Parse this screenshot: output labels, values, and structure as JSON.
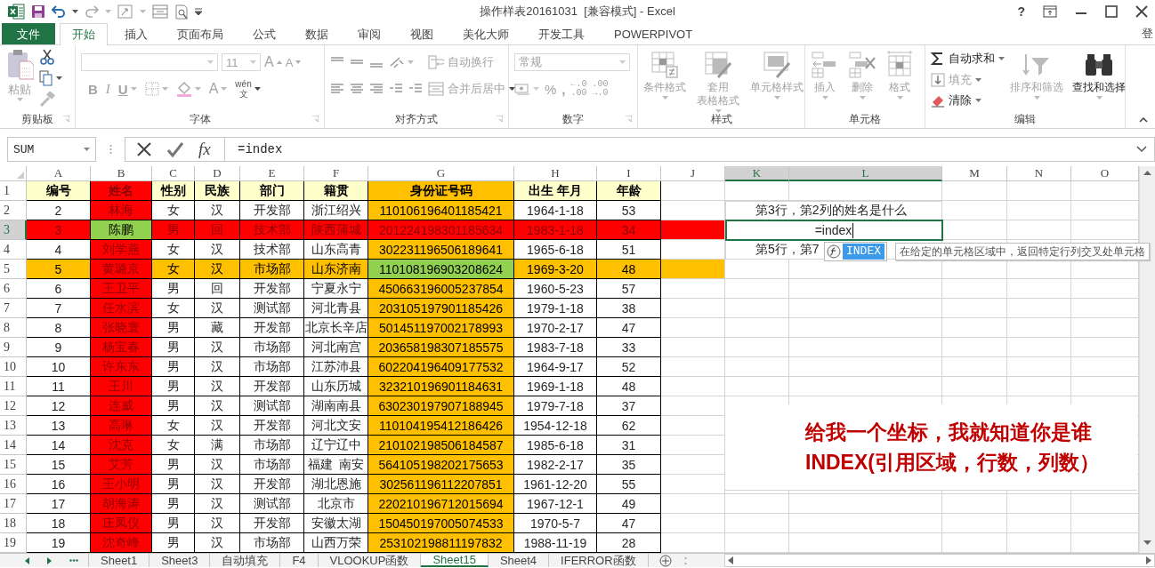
{
  "title_bar": {
    "title": "操作样表20161031  [兼容模式] - Excel",
    "help": "?"
  },
  "ribbon_tabs": [
    {
      "label": "文件",
      "kind": "file",
      "selected": false
    },
    {
      "label": "开始",
      "kind": "tab",
      "selected": true
    },
    {
      "label": "插入",
      "kind": "tab",
      "selected": false
    },
    {
      "label": "页面布局",
      "kind": "tab",
      "selected": false
    },
    {
      "label": "公式",
      "kind": "tab",
      "selected": false
    },
    {
      "label": "数据",
      "kind": "tab",
      "selected": false
    },
    {
      "label": "审阅",
      "kind": "tab",
      "selected": false
    },
    {
      "label": "视图",
      "kind": "tab",
      "selected": false
    },
    {
      "label": "美化大师",
      "kind": "tab",
      "selected": false
    },
    {
      "label": "开发工具",
      "kind": "tab",
      "selected": false
    },
    {
      "label": "POWERPIVOT",
      "kind": "tab",
      "selected": false
    }
  ],
  "account": "登",
  "ribbon": {
    "groups": [
      {
        "label": "剪贴板",
        "kind": "clipboard",
        "paste": {
          "label": "粘贴",
          "disabled": true
        }
      },
      {
        "label": "字体",
        "kind": "font",
        "font_size": "11",
        "grow": "A",
        "shrink": "A",
        "bold": "B",
        "italic": "I",
        "underline": "U",
        "font_color": "A",
        "phonetic": {
          "top": "wén",
          "bottom": "文"
        }
      },
      {
        "label": "对齐方式",
        "kind": "alignment",
        "wrap": {
          "label": "自动换行",
          "disabled": true
        },
        "merge": {
          "label": "合并后居中",
          "disabled": true
        }
      },
      {
        "label": "数字",
        "kind": "number",
        "format": "常规",
        "percent": "%",
        "comma": ",",
        "decimals": [
          {
            "top": "←.0",
            "bottom": ".00"
          },
          {
            "top": ".00",
            "bottom": "→.0"
          }
        ]
      },
      {
        "label": "样式",
        "kind": "large",
        "commands": [
          {
            "lines": [
              "条件格式"
            ],
            "disabled": true
          },
          {
            "lines": [
              "套用",
              "表格格式"
            ],
            "disabled": true
          },
          {
            "lines": [
              "单元格样式"
            ],
            "disabled": true
          }
        ]
      },
      {
        "label": "单元格",
        "kind": "large",
        "commands": [
          {
            "lines": [
              "插入"
            ],
            "disabled": true
          },
          {
            "lines": [
              "删除"
            ],
            "disabled": true
          },
          {
            "lines": [
              "格式"
            ],
            "disabled": true
          }
        ]
      },
      {
        "label": "编辑",
        "kind": "editing",
        "small": [
          {
            "label": "自动求和",
            "disabled": false
          },
          {
            "label": "填充",
            "disabled": true
          },
          {
            "label": "清除",
            "disabled": false
          }
        ],
        "large": [
          {
            "lines": [
              "排序和筛选"
            ],
            "disabled": true
          },
          {
            "lines": [
              "查找和选择"
            ],
            "disabled": false
          }
        ]
      }
    ]
  },
  "formula_bar": {
    "name_box": "SUM",
    "function_button": "fx",
    "content": "=index"
  },
  "grid": {
    "columns": [
      {
        "letter": "A",
        "selected": false
      },
      {
        "letter": "B",
        "selected": false
      },
      {
        "letter": "C",
        "selected": false
      },
      {
        "letter": "D",
        "selected": false
      },
      {
        "letter": "E",
        "selected": false
      },
      {
        "letter": "F",
        "selected": false
      },
      {
        "letter": "G",
        "selected": false
      },
      {
        "letter": "H",
        "selected": false
      },
      {
        "letter": "I",
        "selected": false
      },
      {
        "letter": "J",
        "selected": false
      },
      {
        "letter": "K",
        "selected": true
      },
      {
        "letter": "L",
        "selected": true
      },
      {
        "letter": "M",
        "selected": false
      },
      {
        "letter": "N",
        "selected": false
      },
      {
        "letter": "O",
        "selected": false
      }
    ],
    "rows": [
      {
        "header": "1",
        "selected": false,
        "kind": "header",
        "cells": [
          {
            "text": "编号",
            "color": "#ffffcc"
          },
          {
            "text": "姓名",
            "color": "#ff0000"
          },
          {
            "text": "性别",
            "color": "#ffffcc"
          },
          {
            "text": "民族",
            "color": "#ffffcc"
          },
          {
            "text": "部门",
            "color": "#ffffcc"
          },
          {
            "text": "籍贯",
            "color": "#ffffcc"
          },
          {
            "text": "身份证号码",
            "color": "#ffc000"
          },
          {
            "text": "出生 年月",
            "color": "#ffffcc"
          },
          {
            "text": "年龄",
            "color": "#ffffcc"
          }
        ]
      },
      {
        "header": "2",
        "selected": false,
        "kind": "data",
        "cells": [
          {
            "text": "2"
          },
          {
            "text": "林海",
            "color": "#ff0000"
          },
          {
            "text": "女"
          },
          {
            "text": "汉"
          },
          {
            "text": "开发部"
          },
          {
            "text": "浙江绍兴"
          },
          {
            "text": "110106196401185421",
            "color": "#ffc000"
          },
          {
            "text": "1964-1-18"
          },
          {
            "text": "53"
          }
        ]
      },
      {
        "header": "3",
        "selected": true,
        "kind": "data",
        "cells": [
          {
            "text": "3",
            "color": "#ff0000"
          },
          {
            "text": "陈鹏",
            "color": "#92d050"
          },
          {
            "text": "男",
            "color": "#ff0000"
          },
          {
            "text": "回",
            "color": "#ff0000"
          },
          {
            "text": "技术部",
            "color": "#ff0000"
          },
          {
            "text": "陕西蒲城",
            "color": "#ff0000"
          },
          {
            "text": "201224198301185634",
            "color": "#ff0000"
          },
          {
            "text": "1983-1-18",
            "color": "#ff0000"
          },
          {
            "text": "34",
            "color": "#ff0000"
          },
          {
            "color": "#ff0000"
          }
        ]
      },
      {
        "header": "4",
        "selected": false,
        "kind": "data",
        "cells": [
          {
            "text": "4"
          },
          {
            "text": "刘学燕",
            "color": "#ff0000"
          },
          {
            "text": "女"
          },
          {
            "text": "汉"
          },
          {
            "text": "技术部"
          },
          {
            "text": "山东高青"
          },
          {
            "text": "302231196506189641",
            "color": "#ffc000"
          },
          {
            "text": "1965-6-18"
          },
          {
            "text": "51"
          }
        ]
      },
      {
        "header": "5",
        "selected": false,
        "kind": "data",
        "cells": [
          {
            "text": "5",
            "color": "#ffc000"
          },
          {
            "text": "黄璐京",
            "color": "#ff0000"
          },
          {
            "text": "女",
            "color": "#ffc000"
          },
          {
            "text": "汉",
            "color": "#ffc000"
          },
          {
            "text": "市场部",
            "color": "#ffc000"
          },
          {
            "text": "山东济南",
            "color": "#ffc000"
          },
          {
            "text": "110108196903208624",
            "color": "#92d050"
          },
          {
            "text": "1969-3-20",
            "color": "#ffc000"
          },
          {
            "text": "48",
            "color": "#ffc000"
          },
          {
            "color": "#ffc000"
          }
        ]
      },
      {
        "header": "6",
        "selected": false,
        "kind": "data",
        "cells": [
          {
            "text": "6"
          },
          {
            "text": "王卫平",
            "color": "#ff0000"
          },
          {
            "text": "男"
          },
          {
            "text": "回"
          },
          {
            "text": "开发部"
          },
          {
            "text": "宁夏永宁"
          },
          {
            "text": "450663196005237854",
            "color": "#ffc000"
          },
          {
            "text": "1960-5-23"
          },
          {
            "text": "57"
          }
        ]
      },
      {
        "header": "7",
        "selected": false,
        "kind": "data",
        "cells": [
          {
            "text": "7"
          },
          {
            "text": "任水滨",
            "color": "#ff0000"
          },
          {
            "text": "女"
          },
          {
            "text": "汉"
          },
          {
            "text": "测试部"
          },
          {
            "text": "河北青县"
          },
          {
            "text": "203105197901185426",
            "color": "#ffc000"
          },
          {
            "text": "1979-1-18"
          },
          {
            "text": "38"
          }
        ]
      },
      {
        "header": "8",
        "selected": false,
        "kind": "data",
        "cells": [
          {
            "text": "8"
          },
          {
            "text": "张晓寰",
            "color": "#ff0000"
          },
          {
            "text": "男"
          },
          {
            "text": "藏"
          },
          {
            "text": "开发部"
          },
          {
            "text": "北京长辛店"
          },
          {
            "text": "501451197002178993",
            "color": "#ffc000"
          },
          {
            "text": "1970-2-17"
          },
          {
            "text": "47"
          }
        ]
      },
      {
        "header": "9",
        "selected": false,
        "kind": "data",
        "cells": [
          {
            "text": "9"
          },
          {
            "text": "杨宝春",
            "color": "#ff0000"
          },
          {
            "text": "男"
          },
          {
            "text": "汉"
          },
          {
            "text": "市场部"
          },
          {
            "text": "河北南宫"
          },
          {
            "text": "203658198307185575",
            "color": "#ffc000"
          },
          {
            "text": "1983-7-18"
          },
          {
            "text": "33"
          }
        ]
      },
      {
        "header": "10",
        "selected": false,
        "kind": "data",
        "cells": [
          {
            "text": "10"
          },
          {
            "text": "许东东",
            "color": "#ff0000"
          },
          {
            "text": "男"
          },
          {
            "text": "汉"
          },
          {
            "text": "市场部"
          },
          {
            "text": "江苏沛县"
          },
          {
            "text": "602204196409177532",
            "color": "#ffc000"
          },
          {
            "text": "1964-9-17"
          },
          {
            "text": "52"
          }
        ]
      },
      {
        "header": "11",
        "selected": false,
        "kind": "data",
        "cells": [
          {
            "text": "11"
          },
          {
            "text": "王川",
            "color": "#ff0000"
          },
          {
            "text": "男"
          },
          {
            "text": "汉"
          },
          {
            "text": "开发部"
          },
          {
            "text": "山东历城"
          },
          {
            "text": "323210196901184631",
            "color": "#ffc000"
          },
          {
            "text": "1969-1-18"
          },
          {
            "text": "48"
          }
        ]
      },
      {
        "header": "12",
        "selected": false,
        "kind": "data",
        "cells": [
          {
            "text": "12"
          },
          {
            "text": "连威",
            "color": "#ff0000"
          },
          {
            "text": "男"
          },
          {
            "text": "汉"
          },
          {
            "text": "测试部"
          },
          {
            "text": "湖南南县"
          },
          {
            "text": "630230197907188945",
            "color": "#ffc000"
          },
          {
            "text": "1979-7-18"
          },
          {
            "text": "37"
          }
        ]
      },
      {
        "header": "13",
        "selected": false,
        "kind": "data",
        "cells": [
          {
            "text": "13"
          },
          {
            "text": "高琳",
            "color": "#ff0000"
          },
          {
            "text": "女"
          },
          {
            "text": "汉"
          },
          {
            "text": "开发部"
          },
          {
            "text": "河北文安"
          },
          {
            "text": "110104195412186426",
            "color": "#ffc000"
          },
          {
            "text": "1954-12-18"
          },
          {
            "text": "62"
          }
        ]
      },
      {
        "header": "14",
        "selected": false,
        "kind": "data",
        "cells": [
          {
            "text": "14"
          },
          {
            "text": "沈克",
            "color": "#ff0000"
          },
          {
            "text": "女"
          },
          {
            "text": "满"
          },
          {
            "text": "市场部"
          },
          {
            "text": "辽宁辽中"
          },
          {
            "text": "210102198506184587",
            "color": "#ffc000"
          },
          {
            "text": "1985-6-18"
          },
          {
            "text": "31"
          }
        ]
      },
      {
        "header": "15",
        "selected": false,
        "kind": "data",
        "cells": [
          {
            "text": "15"
          },
          {
            "text": "艾芳",
            "color": "#ff0000"
          },
          {
            "text": "男"
          },
          {
            "text": "汉"
          },
          {
            "text": "市场部"
          },
          {
            "text": "福建  南安"
          },
          {
            "text": "564105198202175653",
            "color": "#ffc000"
          },
          {
            "text": "1982-2-17"
          },
          {
            "text": "35"
          }
        ]
      },
      {
        "header": "16",
        "selected": false,
        "kind": "data",
        "cells": [
          {
            "text": "16"
          },
          {
            "text": "王小明",
            "color": "#ff0000"
          },
          {
            "text": "男"
          },
          {
            "text": "汉"
          },
          {
            "text": "开发部"
          },
          {
            "text": "湖北恩施"
          },
          {
            "text": "302561196112207851",
            "color": "#ffc000"
          },
          {
            "text": "1961-12-20"
          },
          {
            "text": "55"
          }
        ]
      },
      {
        "header": "17",
        "selected": false,
        "kind": "data",
        "cells": [
          {
            "text": "17"
          },
          {
            "text": "胡海涛",
            "color": "#ff0000"
          },
          {
            "text": "男"
          },
          {
            "text": "汉"
          },
          {
            "text": "测试部"
          },
          {
            "text": "北京市"
          },
          {
            "text": "220210196712015694",
            "color": "#ffc000"
          },
          {
            "text": "1967-12-1"
          },
          {
            "text": "49"
          }
        ]
      },
      {
        "header": "18",
        "selected": false,
        "kind": "data",
        "cells": [
          {
            "text": "18"
          },
          {
            "text": "庄凤仪",
            "color": "#ff0000"
          },
          {
            "text": "男"
          },
          {
            "text": "汉"
          },
          {
            "text": "开发部"
          },
          {
            "text": "安徽太湖"
          },
          {
            "text": "150450197005074533",
            "color": "#ffc000"
          },
          {
            "text": "1970-5-7"
          },
          {
            "text": "47"
          }
        ]
      },
      {
        "header": "19",
        "selected": false,
        "kind": "data",
        "cells": [
          {
            "text": "19"
          },
          {
            "text": "沈奇峰",
            "color": "#ff0000"
          },
          {
            "text": "男"
          },
          {
            "text": "汉"
          },
          {
            "text": "市场部"
          },
          {
            "text": "山西万荣"
          },
          {
            "text": "253102198811197832",
            "color": "#ffc000"
          },
          {
            "text": "1988-11-19"
          },
          {
            "text": "28"
          }
        ]
      }
    ]
  },
  "sheet_overlay": {
    "question_1": "第3行，第2列的姓名是什么",
    "active_cell": "=index",
    "question_2": "第5行，第7",
    "autocomplete": {
      "items": [
        {
          "label": "INDEX",
          "selected": true
        }
      ],
      "tooltip": "在给定的单元格区域中，返回特定行列交叉处单元格"
    },
    "callout": {
      "lines": [
        "给我一个坐标，我就知道你是谁",
        "INDEX(引用区域，行数，列数）"
      ]
    }
  },
  "sheet_tabs": [
    {
      "label": "Sheet1",
      "selected": false
    },
    {
      "label": "Sheet3",
      "selected": false
    },
    {
      "label": "自动填充",
      "selected": false
    },
    {
      "label": "F4",
      "selected": false
    },
    {
      "label": "VLOOKUP函数",
      "selected": false
    },
    {
      "label": "Sheet15",
      "selected": true
    },
    {
      "label": "Sheet4",
      "selected": false
    },
    {
      "label": "IFERROR函数",
      "selected": false
    }
  ]
}
